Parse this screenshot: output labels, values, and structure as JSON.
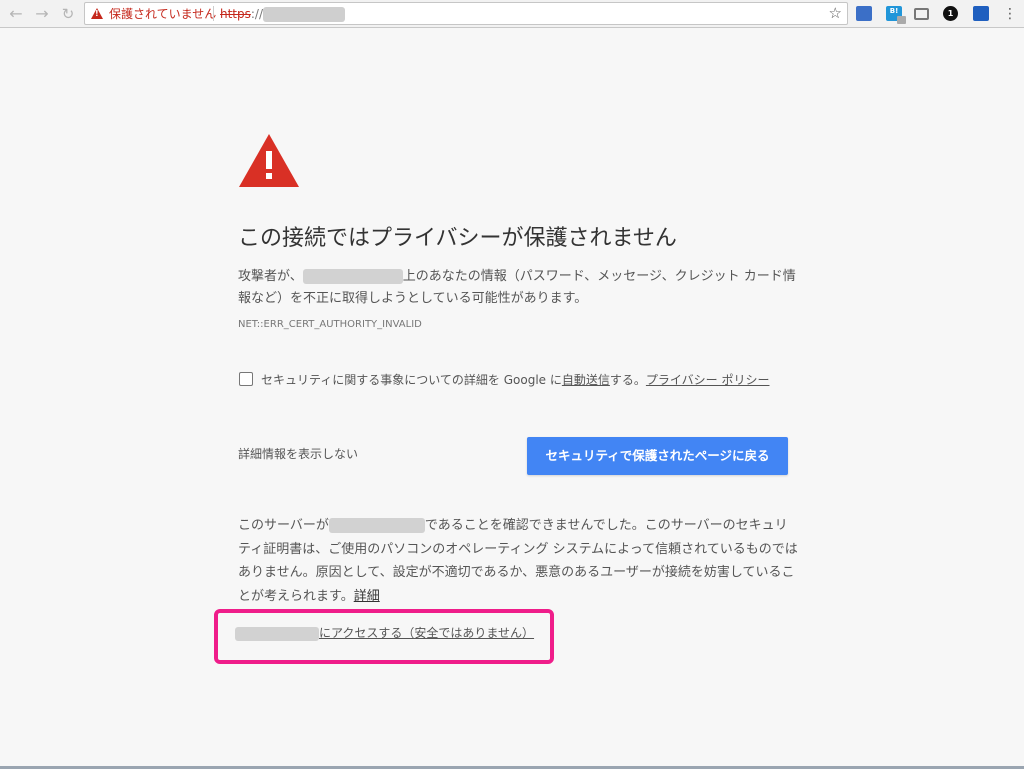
{
  "browser": {
    "security_label": "保護されていません",
    "url_scheme": "https",
    "url_rest": "://",
    "icons": {
      "back": "back-arrow-icon",
      "forward": "forward-arrow-icon",
      "reload": "reload-icon",
      "warning": "warning-triangle-icon",
      "bookmark": "star-icon"
    },
    "extensions": [
      {
        "name": "ext-1-icon"
      },
      {
        "name": "ext-2-icon",
        "text": "B!"
      },
      {
        "name": "cast-icon"
      },
      {
        "name": "onepassword-icon",
        "text": "1"
      },
      {
        "name": "ext-5-icon"
      }
    ]
  },
  "interstitial": {
    "heading": "この接続ではプライバシーが保護されません",
    "para1_prefix": "攻撃者が、",
    "para1_suffix": "上のあなたの情報（パスワード、メッセージ、クレジット カード情報など）を不正に取得しようとしている可能性があります。",
    "error_code": "NET::ERR_CERT_AUTHORITY_INVALID",
    "report": {
      "text_before": "セキュリティに関する事象についての詳細を Google に",
      "auto_send_link": "自動送信",
      "text_mid": "する。",
      "privacy_link": "プライバシー ポリシー"
    },
    "hide_details_link": "詳細情報を表示しない",
    "back_button": "セキュリティで保護されたページに戻る",
    "para2_prefix": "このサーバーが",
    "para2_suffix": "であることを確認できませんでした。このサーバーのセキュリティ証明書は、ご使用のパソコンのオペレーティング システムによって信頼されているものではありません。原因として、設定が不適切であるか、悪意のあるユーザーが接続を妨害していることが考えられます。",
    "details_link": "詳細",
    "proceed_link_suffix": "にアクセスする（安全ではありません）"
  },
  "colors": {
    "warning_red": "#d93025",
    "primary_blue": "#4285f4",
    "highlight_pink": "#ef1d8a"
  }
}
